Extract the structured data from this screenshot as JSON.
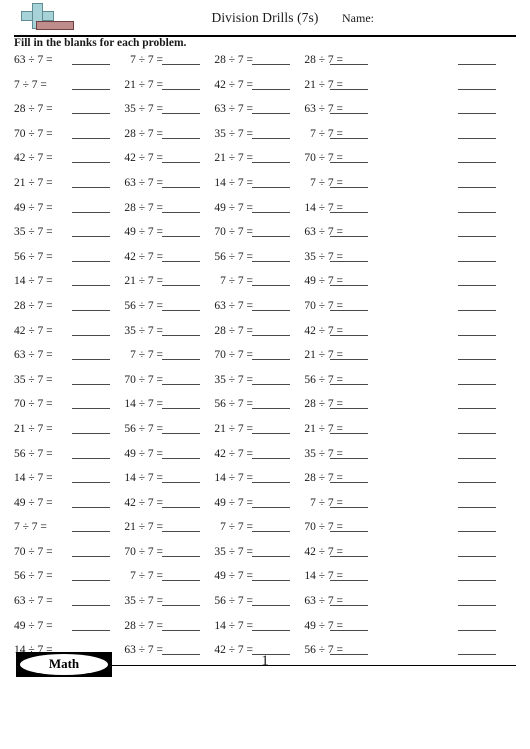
{
  "header": {
    "title": "Division Drills (7s)",
    "name_label": "Name:",
    "instructions": "Fill in the blanks for each problem.",
    "logo_icon": "plus-sign-logo"
  },
  "footer": {
    "subject": "Math",
    "page_number": "1"
  },
  "divisor": 7,
  "operator": "÷",
  "equals": "=",
  "columns": 4,
  "answer_columns_per_row": 5,
  "rows": [
    {
      "problems": [
        "63 ÷ 7 =",
        "7 ÷ 7 =",
        "28 ÷ 7 =",
        "28 ÷ 7 ="
      ]
    },
    {
      "problems": [
        "7 ÷ 7 =",
        "21 ÷ 7 =",
        "42 ÷ 7 =",
        "21 ÷ 7 ="
      ]
    },
    {
      "problems": [
        "28 ÷ 7 =",
        "35 ÷ 7 =",
        "63 ÷ 7 =",
        "63 ÷ 7 ="
      ]
    },
    {
      "problems": [
        "70 ÷ 7 =",
        "28 ÷ 7 =",
        "35 ÷ 7 =",
        "7 ÷ 7 ="
      ]
    },
    {
      "problems": [
        "42 ÷ 7 =",
        "42 ÷ 7 =",
        "21 ÷ 7 =",
        "70 ÷ 7 ="
      ]
    },
    {
      "problems": [
        "21 ÷ 7 =",
        "63 ÷ 7 =",
        "14 ÷ 7 =",
        "7 ÷ 7 ="
      ]
    },
    {
      "problems": [
        "49 ÷ 7 =",
        "28 ÷ 7 =",
        "49 ÷ 7 =",
        "14 ÷ 7 ="
      ]
    },
    {
      "problems": [
        "35 ÷ 7 =",
        "49 ÷ 7 =",
        "70 ÷ 7 =",
        "63 ÷ 7 ="
      ]
    },
    {
      "problems": [
        "56 ÷ 7 =",
        "42 ÷ 7 =",
        "56 ÷ 7 =",
        "35 ÷ 7 ="
      ]
    },
    {
      "problems": [
        "14 ÷ 7 =",
        "21 ÷ 7 =",
        "7 ÷ 7 =",
        "49 ÷ 7 ="
      ]
    },
    {
      "problems": [
        "28 ÷ 7 =",
        "56 ÷ 7 =",
        "63 ÷ 7 =",
        "70 ÷ 7 ="
      ]
    },
    {
      "problems": [
        "42 ÷ 7 =",
        "35 ÷ 7 =",
        "28 ÷ 7 =",
        "42 ÷ 7 ="
      ]
    },
    {
      "problems": [
        "63 ÷ 7 =",
        "7 ÷ 7 =",
        "70 ÷ 7 =",
        "21 ÷ 7 ="
      ]
    },
    {
      "problems": [
        "35 ÷ 7 =",
        "70 ÷ 7 =",
        "35 ÷ 7 =",
        "56 ÷ 7 ="
      ]
    },
    {
      "problems": [
        "70 ÷ 7 =",
        "14 ÷ 7 =",
        "56 ÷ 7 =",
        "28 ÷ 7 ="
      ]
    },
    {
      "problems": [
        "21 ÷ 7 =",
        "56 ÷ 7 =",
        "21 ÷ 7 =",
        "21 ÷ 7 ="
      ]
    },
    {
      "problems": [
        "56 ÷ 7 =",
        "49 ÷ 7 =",
        "42 ÷ 7 =",
        "35 ÷ 7 ="
      ]
    },
    {
      "problems": [
        "14 ÷ 7 =",
        "14 ÷ 7 =",
        "14 ÷ 7 =",
        "28 ÷ 7 ="
      ]
    },
    {
      "problems": [
        "49 ÷ 7 =",
        "42 ÷ 7 =",
        "49 ÷ 7 =",
        "7 ÷ 7 ="
      ]
    },
    {
      "problems": [
        "7 ÷ 7 =",
        "21 ÷ 7 =",
        "7 ÷ 7 =",
        "70 ÷ 7 ="
      ]
    },
    {
      "problems": [
        "70 ÷ 7 =",
        "70 ÷ 7 =",
        "35 ÷ 7 =",
        "42 ÷ 7 ="
      ]
    },
    {
      "problems": [
        "56 ÷ 7 =",
        "7 ÷ 7 =",
        "49 ÷ 7 =",
        "14 ÷ 7 ="
      ]
    },
    {
      "problems": [
        "63 ÷ 7 =",
        "35 ÷ 7 =",
        "56 ÷ 7 =",
        "63 ÷ 7 ="
      ]
    },
    {
      "problems": [
        "49 ÷ 7 =",
        "28 ÷ 7 =",
        "14 ÷ 7 =",
        "49 ÷ 7 ="
      ]
    },
    {
      "problems": [
        "14 ÷ 7 =",
        "63 ÷ 7 =",
        "42 ÷ 7 =",
        "56 ÷ 7 ="
      ]
    }
  ]
}
